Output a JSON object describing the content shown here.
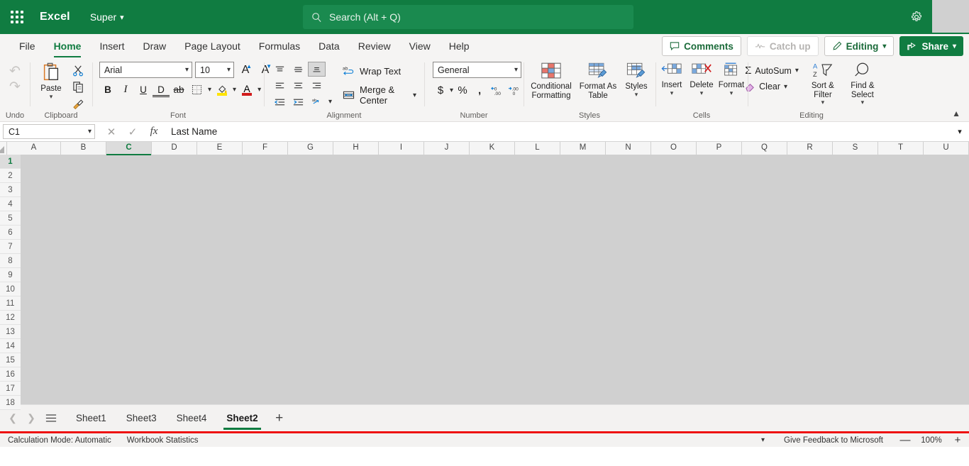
{
  "titlebar": {
    "waffle_name": "app-launcher-icon",
    "app_name": "Excel",
    "document_name": "Super",
    "search_placeholder": "Search (Alt + Q)",
    "gear_name": "settings-icon"
  },
  "ribbon_tabs": [
    {
      "label": "File",
      "active": false
    },
    {
      "label": "Home",
      "active": true
    },
    {
      "label": "Insert",
      "active": false
    },
    {
      "label": "Draw",
      "active": false
    },
    {
      "label": "Page Layout",
      "active": false
    },
    {
      "label": "Formulas",
      "active": false
    },
    {
      "label": "Data",
      "active": false
    },
    {
      "label": "Review",
      "active": false
    },
    {
      "label": "View",
      "active": false
    },
    {
      "label": "Help",
      "active": false
    }
  ],
  "header_actions": {
    "comments": "Comments",
    "catch_up": "Catch up",
    "editing": "Editing",
    "share": "Share"
  },
  "ribbon": {
    "undo_group_label": "Undo",
    "clipboard_group_label": "Clipboard",
    "font_group_label": "Font",
    "alignment_group_label": "Alignment",
    "number_group_label": "Number",
    "styles_group_label": "Styles",
    "cells_group_label": "Cells",
    "editing_group_label": "Editing",
    "paste_label": "Paste",
    "font_name": "Arial",
    "font_size": "10",
    "wrap_text": "Wrap Text",
    "merge_center": "Merge & Center",
    "number_format": "General",
    "conditional_formatting": "Conditional Formatting",
    "format_as_table": "Format As Table",
    "styles": "Styles",
    "insert": "Insert",
    "delete": "Delete",
    "format": "Format",
    "autosum": "AutoSum",
    "clear": "Clear",
    "sort_filter": "Sort & Filter",
    "find_select": "Find & Select"
  },
  "formula_bar": {
    "name_box": "C1",
    "content": "Last Name"
  },
  "grid": {
    "columns": [
      "A",
      "B",
      "C",
      "D",
      "E",
      "F",
      "G",
      "H",
      "I",
      "J",
      "K",
      "L",
      "M",
      "N",
      "O",
      "P",
      "Q",
      "R",
      "S",
      "T",
      "U"
    ],
    "selected_column": "C",
    "rows": [
      1,
      2,
      3,
      4,
      5,
      6,
      7,
      8,
      9,
      10,
      11,
      12,
      13,
      14,
      15,
      16,
      17,
      18
    ],
    "selected_row": 1
  },
  "sheet_tabs": {
    "items": [
      {
        "label": "Sheet1",
        "active": false
      },
      {
        "label": "Sheet3",
        "active": false
      },
      {
        "label": "Sheet4",
        "active": false
      },
      {
        "label": "Sheet2",
        "active": true
      }
    ],
    "add_label": "+"
  },
  "status_bar": {
    "calculation_mode": "Calculation Mode: Automatic",
    "workbook_statistics": "Workbook Statistics",
    "feedback": "Give Feedback to Microsoft",
    "zoom": "100%",
    "zoom_out": "—",
    "zoom_in": "+"
  },
  "colors": {
    "brand_green": "#107c41",
    "accent_blue": "#0078d4",
    "highlight_red": "#ee1111",
    "grid_gray": "#d0d0d0"
  }
}
